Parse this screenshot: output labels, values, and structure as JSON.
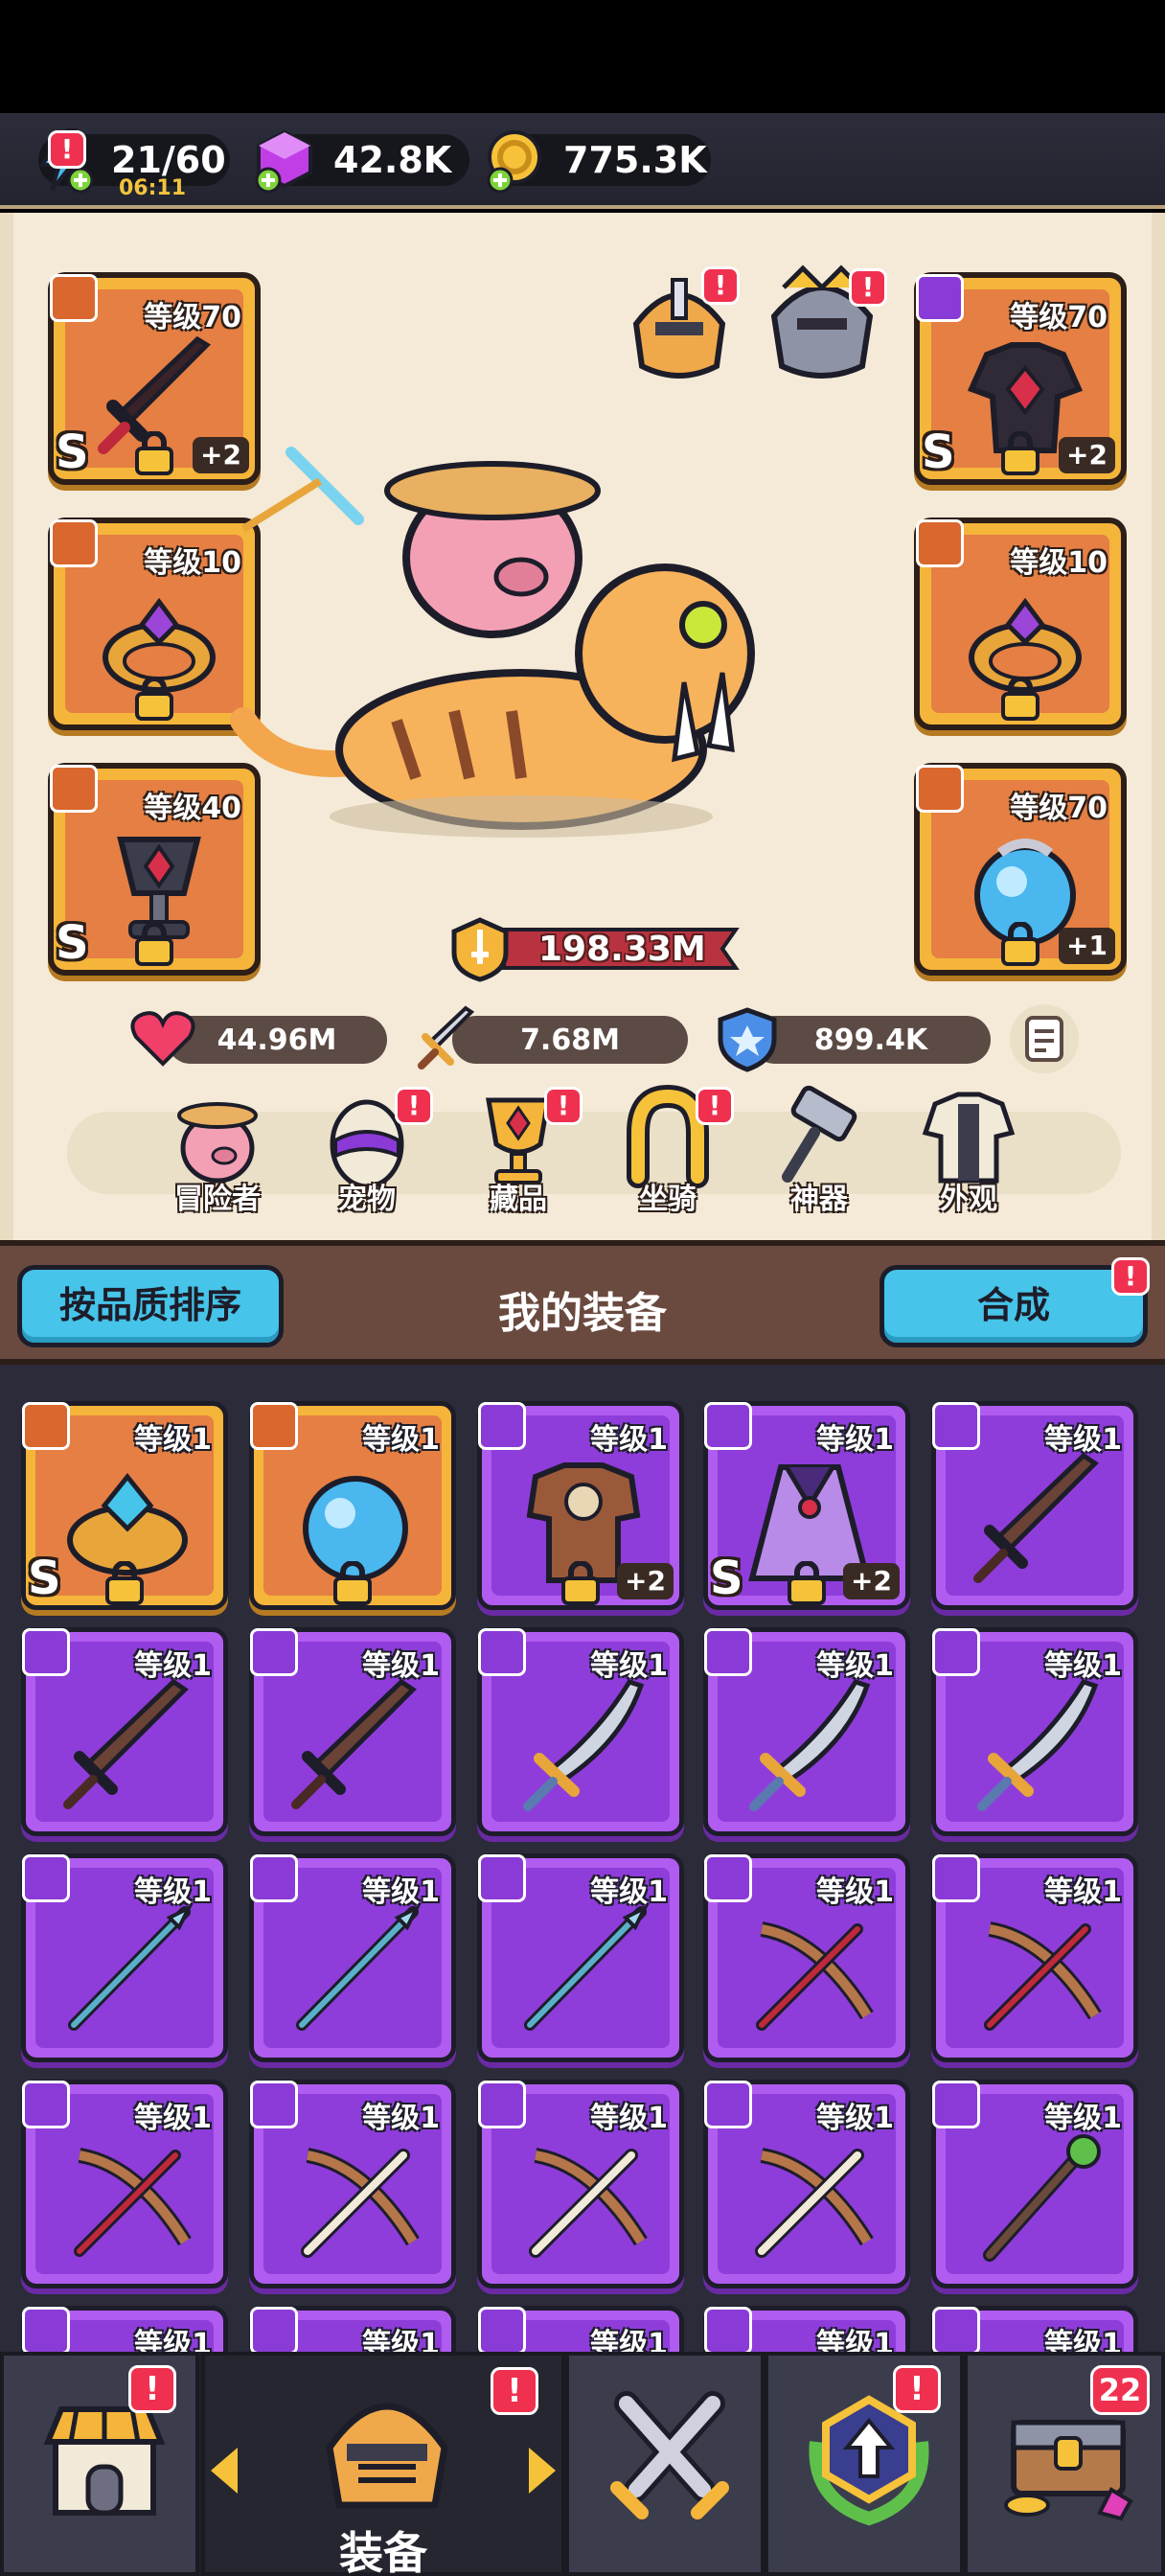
{
  "resources": {
    "energy": "21/60",
    "energy_timer": "06:11",
    "gems": "42.8K",
    "gold": "775.3K"
  },
  "hero": {
    "power": "198.33M",
    "stats": {
      "hp": "44.96M",
      "attack": "7.68M",
      "defense": "899.4K"
    },
    "slots": {
      "weapon": {
        "level": "等级70",
        "grade": "S",
        "plus": "+2"
      },
      "armor": {
        "level": "等级70",
        "grade": "S",
        "plus": "+2"
      },
      "ring_left": {
        "level": "等级10"
      },
      "ring_right": {
        "level": "等级10"
      },
      "amulet_left": {
        "level": "等级40",
        "grade": "S"
      },
      "amulet_right": {
        "level": "等级70",
        "plus": "+1"
      }
    },
    "nav": [
      {
        "label": "冒险者",
        "icon": "pig-icon"
      },
      {
        "label": "宠物",
        "icon": "egg-icon"
      },
      {
        "label": "藏品",
        "icon": "trophy-icon"
      },
      {
        "label": "坐骑",
        "icon": "horseshoe-icon"
      },
      {
        "label": "神器",
        "icon": "hammer-icon"
      },
      {
        "label": "外观",
        "icon": "outfit-icon"
      }
    ]
  },
  "inventory": {
    "title": "我的装备",
    "sort_label": "按品质排序",
    "merge_label": "合成",
    "level_label": "等级1",
    "items": [
      {
        "rarity": "legend",
        "icon": "ring-icon",
        "grade": "S"
      },
      {
        "rarity": "legend",
        "icon": "amulet-icon"
      },
      {
        "rarity": "epic",
        "icon": "armor-icon",
        "plus": "+2"
      },
      {
        "rarity": "epic",
        "icon": "cloak-icon",
        "grade": "S",
        "plus": "+2"
      },
      {
        "rarity": "epic",
        "icon": "sword-icon"
      },
      {
        "rarity": "epic",
        "icon": "sword-icon"
      },
      {
        "rarity": "epic",
        "icon": "sword-icon"
      },
      {
        "rarity": "epic",
        "icon": "scimitar-icon"
      },
      {
        "rarity": "epic",
        "icon": "scimitar-icon"
      },
      {
        "rarity": "epic",
        "icon": "scimitar-icon"
      },
      {
        "rarity": "epic",
        "icon": "spear-icon"
      },
      {
        "rarity": "epic",
        "icon": "spear-icon"
      },
      {
        "rarity": "epic",
        "icon": "spear-icon"
      },
      {
        "rarity": "epic",
        "icon": "crossbow-icon"
      },
      {
        "rarity": "epic",
        "icon": "crossbow-icon"
      },
      {
        "rarity": "epic",
        "icon": "crossbow-icon"
      },
      {
        "rarity": "epic",
        "icon": "bone-crossbow-icon"
      },
      {
        "rarity": "epic",
        "icon": "bone-crossbow-icon"
      },
      {
        "rarity": "epic",
        "icon": "bone-crossbow-icon"
      },
      {
        "rarity": "epic",
        "icon": "staff-icon"
      },
      {
        "rarity": "epic",
        "icon": "sword-icon"
      },
      {
        "rarity": "epic",
        "icon": "sword-icon"
      },
      {
        "rarity": "epic",
        "icon": "sword-icon"
      },
      {
        "rarity": "epic",
        "icon": "sword-icon"
      },
      {
        "rarity": "epic",
        "icon": "sword-icon"
      }
    ]
  },
  "bottom_nav": {
    "equip_label": "装备",
    "chest_count": "22"
  },
  "colors": {
    "legend": "#f5b53a",
    "epic": "#b15cf0",
    "accent": "#46c4ea",
    "alert": "#f0304f"
  }
}
